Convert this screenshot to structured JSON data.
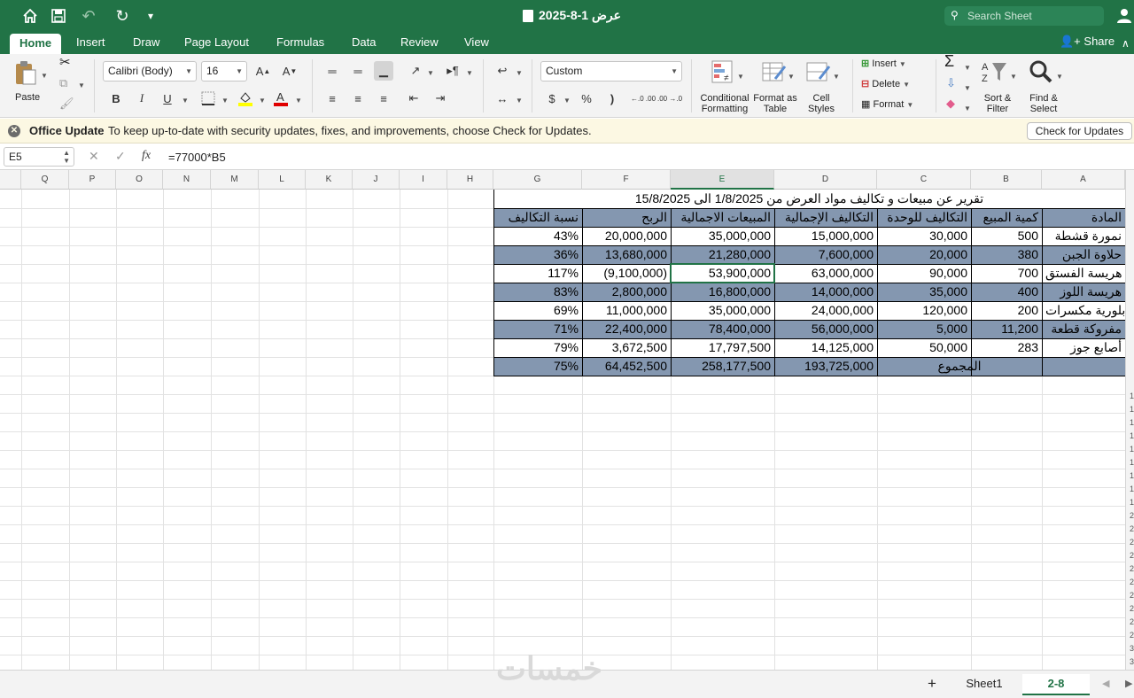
{
  "window": {
    "title": "عرض 1-8-2025",
    "search_placeholder": "Search Sheet"
  },
  "ribbon_tabs": [
    "Home",
    "Insert",
    "Draw",
    "Page Layout",
    "Formulas",
    "Data",
    "Review",
    "View"
  ],
  "share_label": "Share",
  "ribbon": {
    "paste": "Paste",
    "font_name": "Calibri (Body)",
    "font_size": "16",
    "number_format": "Custom",
    "conditional_formatting": "Conditional Formatting",
    "format_as_table": "Format as Table",
    "cell_styles": "Cell Styles",
    "insert": "Insert",
    "delete": "Delete",
    "format": "Format",
    "sort_filter": "Sort & Filter",
    "find_select": "Find & Select",
    "bold": "B",
    "italic": "I",
    "underline": "U",
    "currency": "$",
    "percent": "%",
    "comma": ")",
    "increase_decimal": "←.0 .00",
    "decrease_decimal": ".00 →.0"
  },
  "notice": {
    "title": "Office Update",
    "message": "To keep up-to-date with security updates, fixes, and improvements, choose Check for Updates.",
    "button": "Check for Updates"
  },
  "formula_bar": {
    "name_box": "E5",
    "formula": "=77000*B5"
  },
  "columns": [
    "Q",
    "P",
    "O",
    "N",
    "M",
    "L",
    "K",
    "J",
    "I",
    "H",
    "G",
    "F",
    "E",
    "D",
    "C",
    "B",
    "A"
  ],
  "selected_column": "E",
  "report": {
    "title": "تقرير عن مبيعات و تكاليف مواد العرض من 1/8/2025 الى 15/8/2025",
    "headers": [
      "المادة",
      "كمية المبيع",
      "التكاليف للوحدة",
      "التكاليف الإجمالية",
      "المبيعات الاجمالية",
      "الربح",
      "نسبة التكاليف"
    ],
    "rows": [
      [
        "نمورة قشطة",
        "500",
        "30,000",
        "15,000,000",
        "35,000,000",
        "20,000,000",
        "43%"
      ],
      [
        "حلاوة الجبن",
        "380",
        "20,000",
        "7,600,000",
        "21,280,000",
        "13,680,000",
        "36%"
      ],
      [
        "هريسة الفستق",
        "700",
        "90,000",
        "63,000,000",
        "53,900,000",
        "(9,100,000)",
        "117%"
      ],
      [
        "هريسة اللوز",
        "400",
        "35,000",
        "14,000,000",
        "16,800,000",
        "2,800,000",
        "83%"
      ],
      [
        "بلورية مكسرات",
        "200",
        "120,000",
        "24,000,000",
        "35,000,000",
        "11,000,000",
        "69%"
      ],
      [
        "مفروكة قطعة",
        "11,200",
        "5,000",
        "56,000,000",
        "78,400,000",
        "22,400,000",
        "71%"
      ],
      [
        "أصابع جوز",
        "283",
        "50,000",
        "14,125,000",
        "17,797,500",
        "3,672,500",
        "79%"
      ]
    ],
    "total_label": "المجموع",
    "totals": [
      "193,725,000",
      "258,177,500",
      "64,452,500",
      "75%"
    ],
    "band_color": "#8497b0"
  },
  "sheets": [
    "Sheet1",
    "2-8"
  ],
  "active_sheet": "2-8",
  "add_sheet": "+",
  "watermark": "خمسات",
  "row_numbers": [
    "1",
    "1",
    "1",
    "1",
    "1",
    "1",
    "1",
    "1",
    "1",
    "2",
    "2",
    "2",
    "2",
    "2",
    "2",
    "2",
    "2",
    "2",
    "2",
    "3",
    "3"
  ],
  "accent": "#217346"
}
